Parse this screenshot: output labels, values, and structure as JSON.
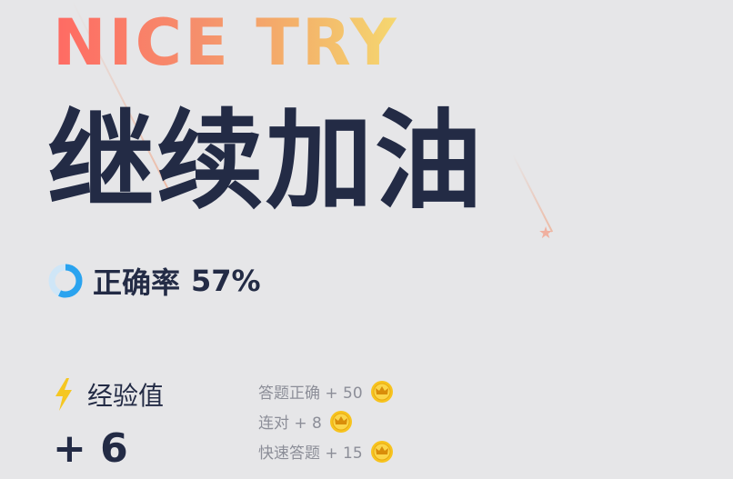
{
  "headline": {
    "en": "NICE TRY",
    "cn": "继续加油"
  },
  "accuracy": {
    "label": "正确率",
    "value": "57%",
    "percent": 57,
    "ring_colors": [
      "#2aa3ef",
      "#cfe6f7"
    ]
  },
  "experience": {
    "label": "经验值",
    "total": "+ 6",
    "icon": "lightning-icon",
    "icon_color": "#f5c722"
  },
  "breakdown": [
    {
      "text": "答题正确 + 50",
      "icon": "crown-coin-icon"
    },
    {
      "text": "连对 + 8",
      "icon": "crown-coin-icon"
    },
    {
      "text": "快速答题 + 15",
      "icon": "crown-coin-icon"
    }
  ],
  "colors": {
    "background": "#e6e6e8",
    "headline_gradient": [
      "#ff6a63",
      "#f58f6c",
      "#f4b46a",
      "#f5d870"
    ],
    "text_dark": "#232b45",
    "text_muted": "#8c8e98",
    "coin": "#f7c31e"
  }
}
